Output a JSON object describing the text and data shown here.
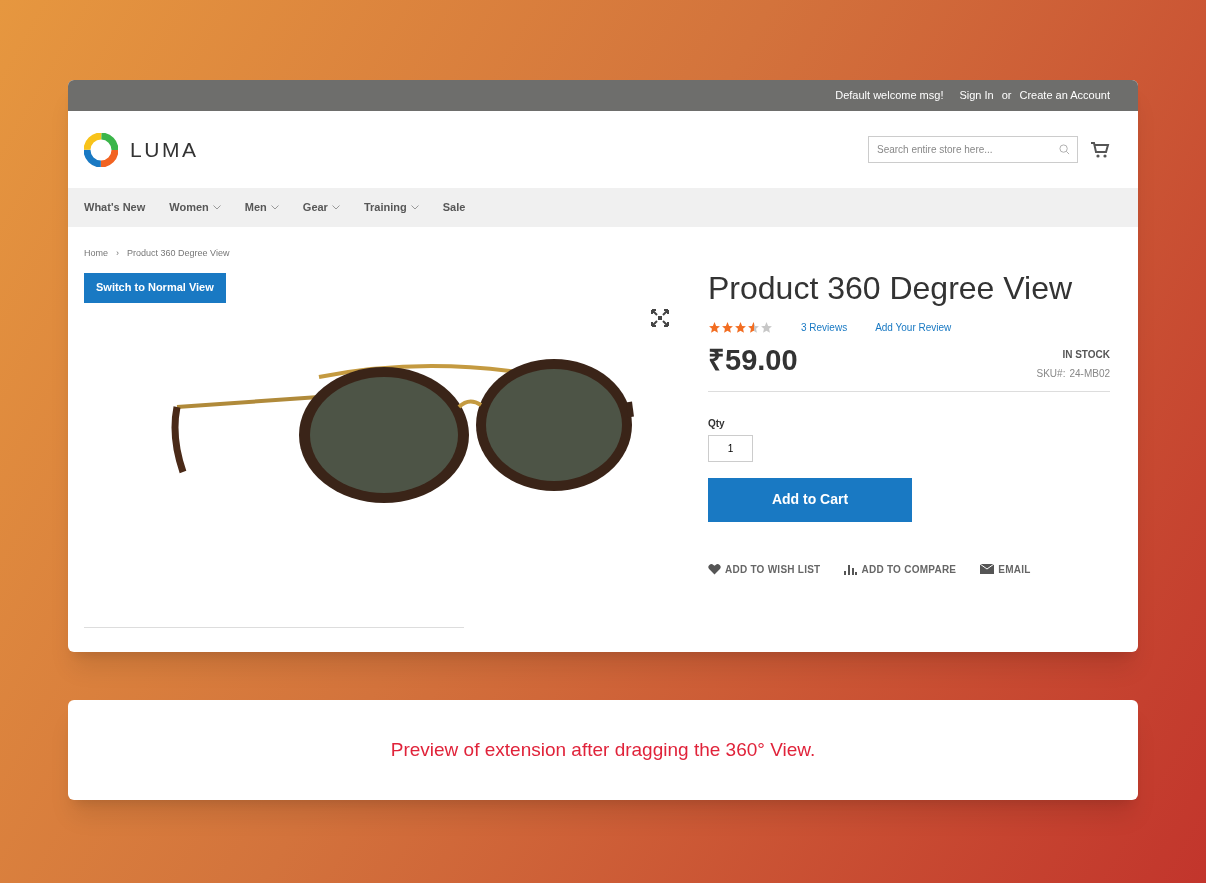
{
  "header": {
    "welcome": "Default welcome msg!",
    "sign_in": "Sign In",
    "or": "or",
    "create_account": "Create an Account"
  },
  "logo": {
    "text": "LUMA"
  },
  "search": {
    "placeholder": "Search entire store here..."
  },
  "nav": [
    {
      "label": "What's New",
      "dropdown": false
    },
    {
      "label": "Women",
      "dropdown": true
    },
    {
      "label": "Men",
      "dropdown": true
    },
    {
      "label": "Gear",
      "dropdown": true
    },
    {
      "label": "Training",
      "dropdown": true
    },
    {
      "label": "Sale",
      "dropdown": false
    }
  ],
  "breadcrumbs": [
    "Home",
    "Product 360 Degree View"
  ],
  "breadcrumb_separator": "›",
  "switch_button": "Switch to Normal View",
  "product": {
    "title": "Product 360 Degree View",
    "stars": 3.5,
    "reviews": "3 Reviews",
    "add_review": "Add Your Review",
    "price": "₹59.00",
    "stock": "IN STOCK",
    "sku_label": "SKU#:",
    "sku": "24-MB02",
    "qty_label": "Qty",
    "qty": "1",
    "add_to_cart": "Add to Cart",
    "actions": [
      {
        "kind": "wishlist",
        "label": "ADD TO WISH LIST"
      },
      {
        "kind": "compare",
        "label": "ADD TO COMPARE"
      },
      {
        "kind": "email",
        "label": "EMAIL"
      }
    ]
  },
  "caption": "Preview of extension after dragging the 360° View."
}
